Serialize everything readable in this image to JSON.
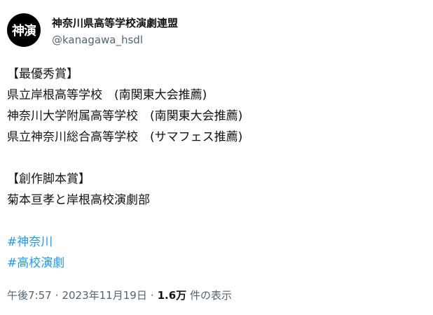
{
  "account": {
    "avatar_text": "神演",
    "display_name": "神奈川県高等学校演劇連盟",
    "handle": "@kanagawa_hsdl"
  },
  "tweet": {
    "lines": [
      "【最優秀賞】",
      "県立岸根高等学校　(南関東大会推薦)",
      "神奈川大学附属高等学校　(南関東大会推薦)",
      "県立神奈川総合高等学校　(サマフェス推薦)",
      "",
      "【創作脚本賞】",
      "菊本亘孝と岸根高校演劇部",
      ""
    ],
    "hashtags": [
      "#神奈川",
      "#高校演劇"
    ]
  },
  "meta": {
    "time": "午後7:57",
    "dot": "·",
    "date": "2023年11月19日",
    "views_count": "1.6万",
    "views_label": "件の表示"
  },
  "colors": {
    "link": "#1d9bf0",
    "secondary": "#536471",
    "text": "#0f1419"
  }
}
